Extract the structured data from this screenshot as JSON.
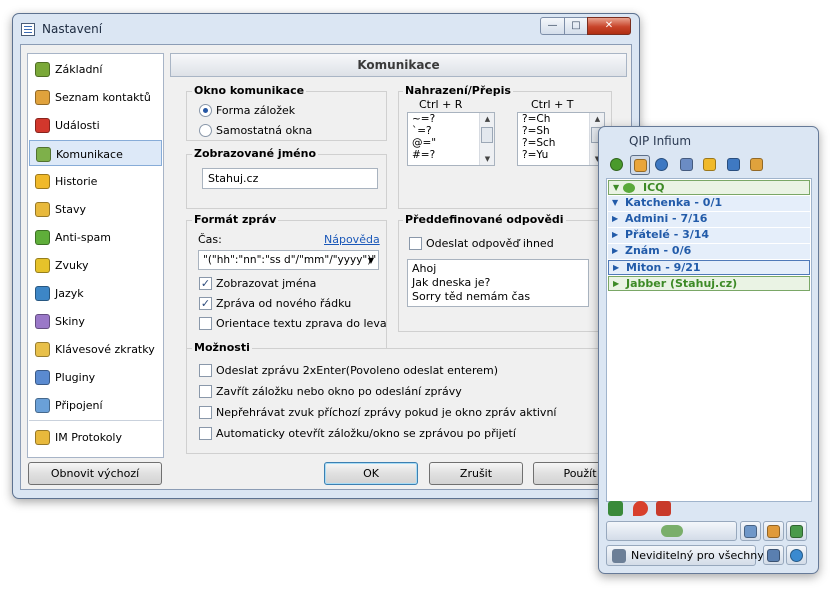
{
  "window": {
    "title": "Nastavení",
    "controls": {
      "minimize": "—",
      "maximize": "□",
      "close": "✕"
    }
  },
  "sidebar": {
    "items": [
      {
        "label": "Základní",
        "icon": "basic-icon",
        "color": "#7aa838"
      },
      {
        "label": "Seznam kontaktů",
        "icon": "contacts-icon",
        "color": "#e0a23c"
      },
      {
        "label": "Události",
        "icon": "events-icon",
        "color": "#d2372c"
      },
      {
        "label": "Komunikace",
        "icon": "communication-icon",
        "color": "#7eb04a"
      },
      {
        "label": "Historie",
        "icon": "history-icon",
        "color": "#f0b92a"
      },
      {
        "label": "Stavy",
        "icon": "status-icon",
        "color": "#e8b93c"
      },
      {
        "label": "Anti-spam",
        "icon": "antispam-icon",
        "color": "#5fae3a"
      },
      {
        "label": "Zvuky",
        "icon": "sounds-icon",
        "color": "#e6c22a"
      },
      {
        "label": "Jazyk",
        "icon": "language-icon",
        "color": "#3d86c6"
      },
      {
        "label": "Skiny",
        "icon": "skins-icon",
        "color": "#9a78c8"
      },
      {
        "label": "Klávesové zkratky",
        "icon": "shortcuts-icon",
        "color": "#e8c04a"
      },
      {
        "label": "Pluginy",
        "icon": "plugins-icon",
        "color": "#5a8ad0"
      },
      {
        "label": "Připojení",
        "icon": "connection-icon",
        "color": "#6aa0d8"
      },
      {
        "label": "IM Protokoly",
        "icon": "protocols-icon",
        "color": "#e8b93c"
      }
    ],
    "selected": "Komunikace"
  },
  "content": {
    "header": "Komunikace",
    "window_group": {
      "title": "Okno komunikace",
      "options": [
        "Forma záložek",
        "Samostatná okna"
      ],
      "selected": "Forma záložek"
    },
    "display_name": {
      "title": "Zobrazované jméno",
      "value": "Stahuj.cz"
    },
    "replace": {
      "title": "Nahrazení/Přepis",
      "ctrl_r": {
        "label": "Ctrl + R",
        "items": [
          "~=?",
          "`=?",
          "@=\"",
          "#=?"
        ]
      },
      "ctrl_t": {
        "label": "Ctrl + T",
        "items": [
          "?=Ch",
          "?=Sh",
          "?=Sch",
          "?=Yu"
        ]
      }
    },
    "format": {
      "title": "Formát zpráv",
      "time_label": "Čas:",
      "help_link": "Nápověda",
      "time_format": "\"(\"hh\":\"nn\":\"ss d\"/\"mm\"/\"yyyy\")\"",
      "options": [
        {
          "label": "Zobrazovat jména",
          "checked": true
        },
        {
          "label": "Zpráva od nového řádku",
          "checked": true
        },
        {
          "label": "Orientace textu zprava do leva",
          "checked": false
        }
      ]
    },
    "predefined": {
      "title": "Předdefinované odpovědi",
      "send_now": {
        "label": "Odeslat odpověď ihned",
        "checked": false
      },
      "replies": [
        "Ahoj",
        "Jak dneska je?",
        "Sorry těd nemám čas"
      ]
    },
    "options": {
      "title": "Možnosti",
      "items": [
        {
          "label": "Odeslat zprávu 2xEnter(Povoleno odeslat enterem)",
          "checked": false
        },
        {
          "label": "Zavřít záložku nebo okno po odeslání zprávy",
          "checked": false
        },
        {
          "label": "Nepřehrávat zvuk příchozí zprávy pokud je okno zpráv aktivní",
          "checked": false
        },
        {
          "label": "Automaticky otevřít záložku/okno se zprávou po přijetí",
          "checked": false
        }
      ]
    }
  },
  "buttons": {
    "reset": "Obnovit výchozí",
    "ok": "OK",
    "cancel": "Zrušit",
    "apply": "Použít"
  },
  "qip": {
    "title": "QIP Infium",
    "toolbar": [
      {
        "name": "main-status-icon",
        "color": "#4a9a2c"
      },
      {
        "name": "g-icon",
        "color": "#e9a53a"
      },
      {
        "name": "globe-icon",
        "color": "#3d78c2"
      },
      {
        "name": "photo-icon",
        "color": "#6b8cc4"
      },
      {
        "name": "history-h-icon",
        "color": "#f0b92a"
      },
      {
        "name": "notes-icon",
        "color": "#3f79c2"
      },
      {
        "name": "plugins-icon",
        "color": "#e0a23c"
      }
    ],
    "groups": [
      {
        "name": "ICQ",
        "type": "account",
        "arrow": "▼"
      },
      {
        "name": "Katchenka - 0/1",
        "type": "sub",
        "arrow": "▼"
      },
      {
        "name": "Admini - 7/16",
        "type": "sub",
        "arrow": "▶"
      },
      {
        "name": "Přátelé - 3/14",
        "type": "sub",
        "arrow": "▶"
      },
      {
        "name": "Znám - 0/6",
        "type": "sub",
        "arrow": "▶"
      },
      {
        "name": "Miton - 9/21",
        "type": "sub-selected",
        "arrow": "▶"
      },
      {
        "name": "Jabber (Stahuj.cz)",
        "type": "account",
        "arrow": "▶"
      }
    ],
    "status_icons": [
      {
        "name": "icq-status-icon",
        "color": "#3a8a3a"
      },
      {
        "name": "pin-icon",
        "color": "#d8402c"
      },
      {
        "name": "s-icon",
        "color": "#c83a2a"
      }
    ],
    "status_label": "Neviditelný pro všechny"
  }
}
